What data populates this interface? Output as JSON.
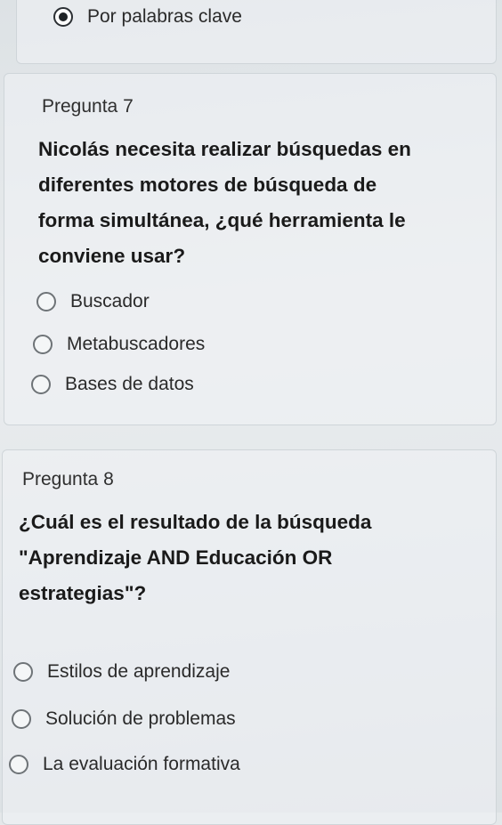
{
  "top_option": {
    "label": "Por palabras clave",
    "selected": true
  },
  "question7": {
    "label": "Pregunta 7",
    "text": "Nicolás necesita realizar búsquedas en diferentes motores de búsqueda de forma simultánea, ¿qué herramienta le conviene usar?",
    "lines": [
      "Nicolás necesita realizar búsquedas en",
      "diferentes motores de búsqueda de",
      "forma simultánea, ¿qué herramienta le",
      "conviene usar?"
    ],
    "options": [
      "Buscador",
      "Metabuscadores",
      "Bases de datos"
    ]
  },
  "question8": {
    "label": "Pregunta 8",
    "lines": [
      "¿Cuál es el resultado de la búsqueda",
      "\"Aprendizaje AND Educación OR",
      "estrategias\"?"
    ],
    "options": [
      "Estilos de aprendizaje",
      "Solución de problemas",
      "La evaluación formativa"
    ]
  }
}
